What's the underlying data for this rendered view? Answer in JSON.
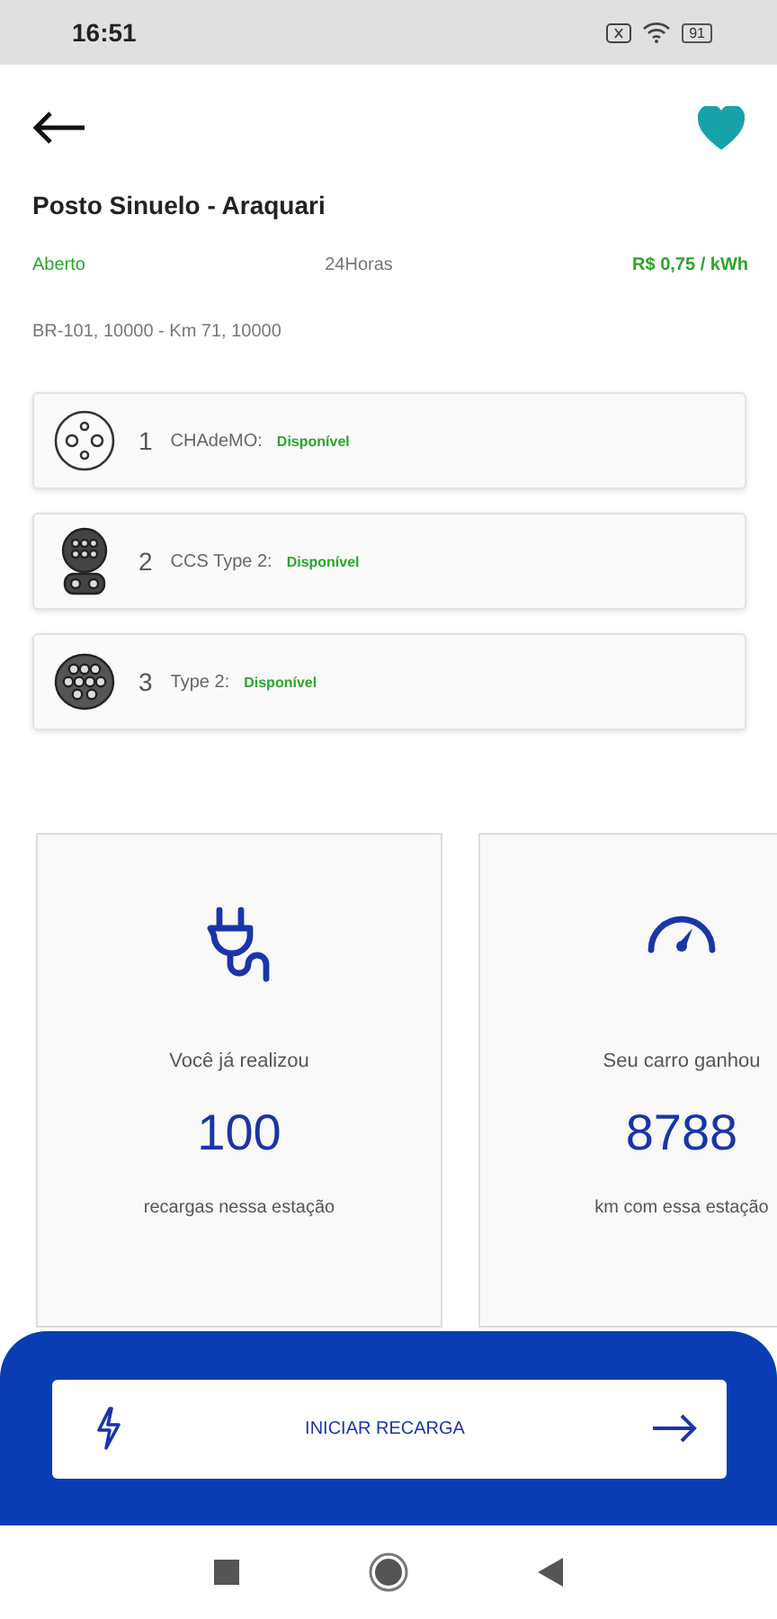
{
  "status_bar": {
    "time": "16:51",
    "battery": "91"
  },
  "station": {
    "favorite": true,
    "name": "Posto Sinuelo - Araquari",
    "status": "Aberto",
    "hours": "24Horas",
    "price": "R$ 0,75 / kWh",
    "address": "BR-101, 10000 - Km 71, 10000"
  },
  "connectors": [
    {
      "kind": "chademo",
      "number": "1",
      "name": "CHAdeMO:",
      "status": "Disponível"
    },
    {
      "kind": "ccs2",
      "number": "2",
      "name": "CCS Type 2:",
      "status": "Disponível"
    },
    {
      "kind": "type2",
      "number": "3",
      "name": "Type 2:",
      "status": "Disponível"
    }
  ],
  "stats": [
    {
      "kind": "plug",
      "caption": "Você já realizou",
      "value": "100",
      "unit": "recargas nessa estação"
    },
    {
      "kind": "gauge",
      "caption": "Seu carro ganhou",
      "value": "8788",
      "unit": "km com essa estação"
    }
  ],
  "action": {
    "label": "INICIAR RECARGA"
  }
}
